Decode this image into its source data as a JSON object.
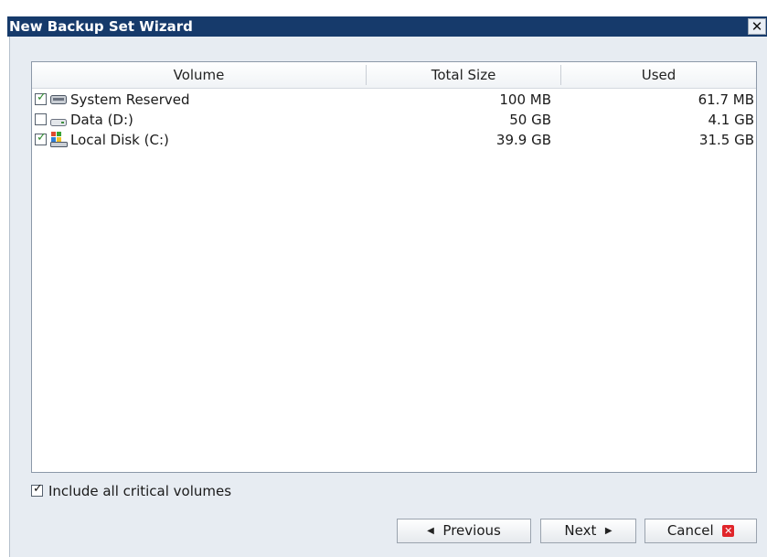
{
  "window": {
    "title": "New Backup Set Wizard",
    "close_glyph": "✕"
  },
  "volumes": {
    "columns": [
      "Volume",
      "Total Size",
      "Used"
    ],
    "rows": [
      {
        "name": "System Reserved",
        "total": "100 MB",
        "used": "61.7 MB",
        "checked": true,
        "icon": "drive-icon"
      },
      {
        "name": "Data (D:)",
        "total": "50 GB",
        "used": "4.1 GB",
        "checked": false,
        "icon": "removable-drive-icon"
      },
      {
        "name": "Local Disk (C:)",
        "total": "39.9 GB",
        "used": "31.5 GB",
        "checked": true,
        "icon": "windows-drive-icon"
      }
    ]
  },
  "options": {
    "include_critical_label": "Include all critical volumes",
    "include_critical_checked": true
  },
  "buttons": {
    "previous": "Previous",
    "next": "Next",
    "cancel": "Cancel"
  },
  "colors": {
    "titlebar": "#163a6b",
    "panel": "#e7ecf2",
    "check": "#2d8a2d",
    "cancel_icon": "#e0252a"
  }
}
